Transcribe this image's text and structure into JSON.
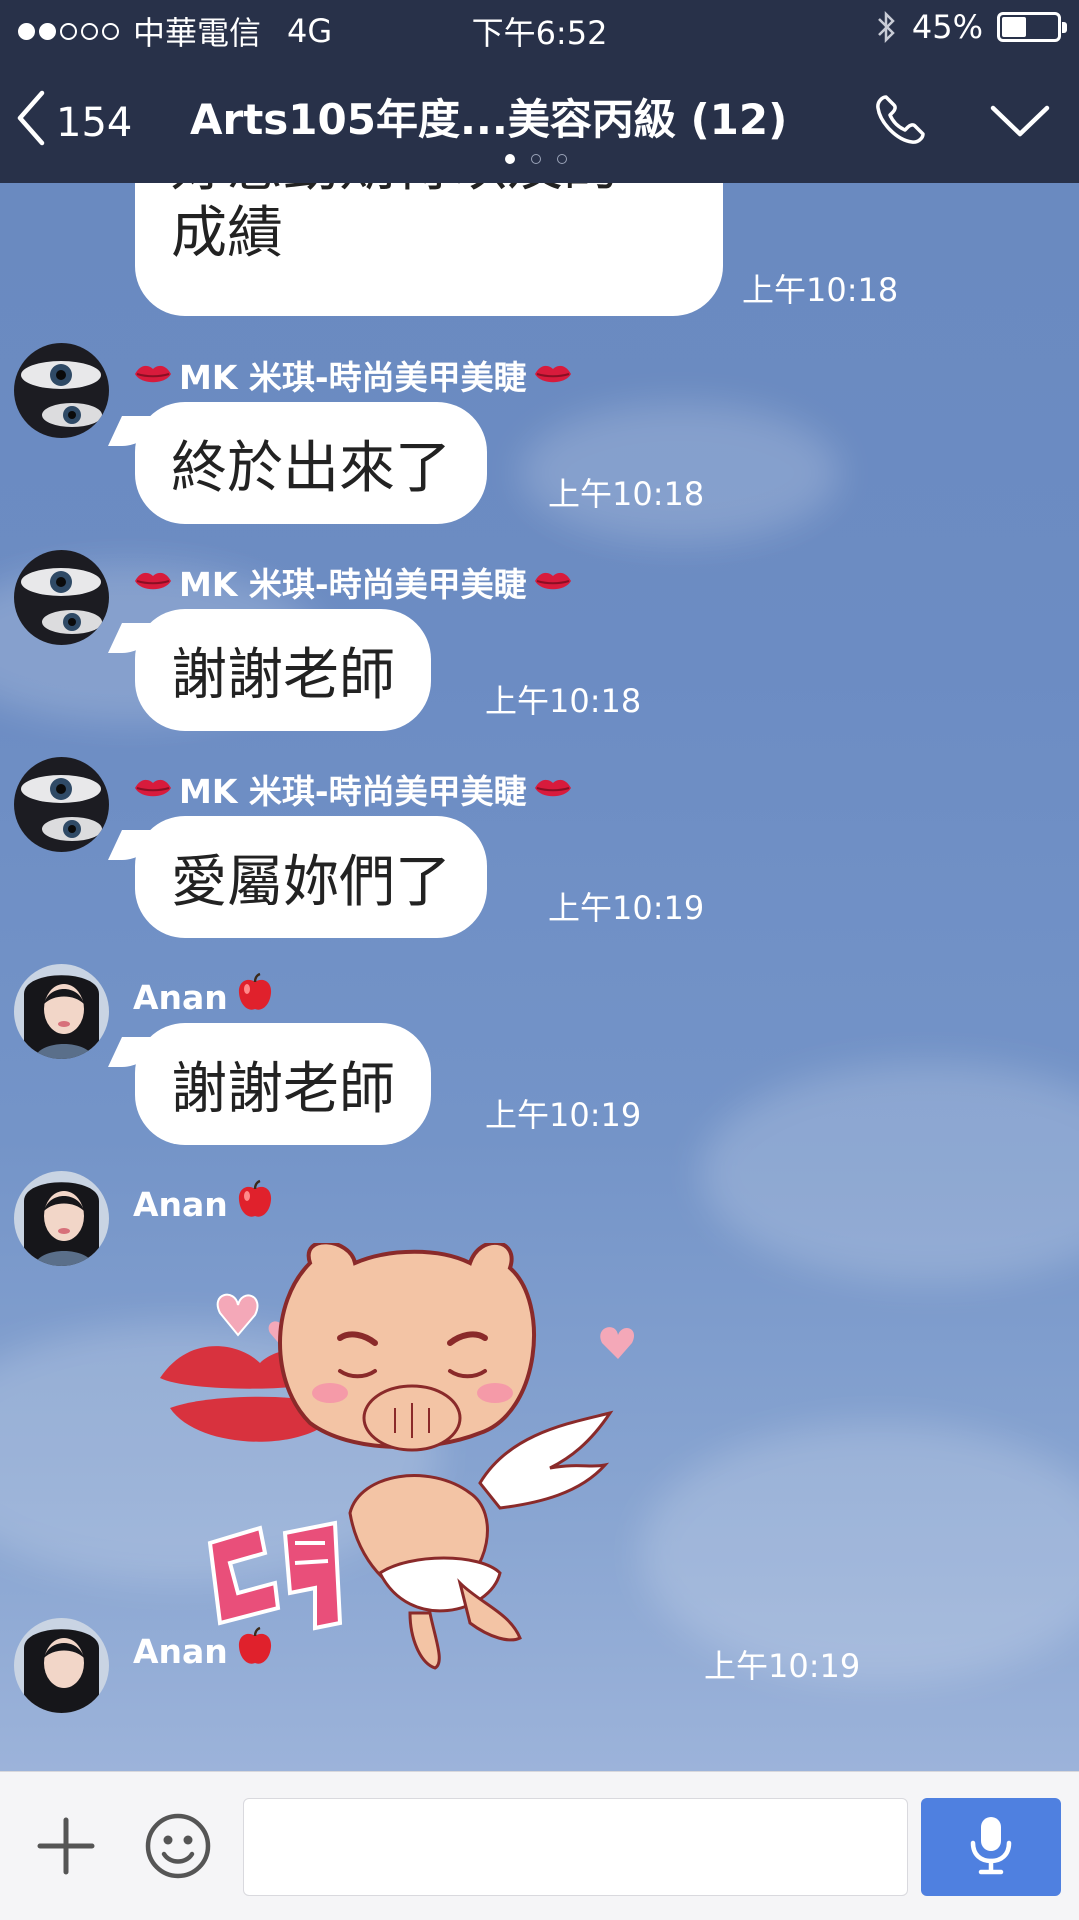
{
  "status_bar": {
    "carrier": "中華電信",
    "network": "4G",
    "time": "下午6:52",
    "battery": "45%",
    "battery_level": 0.45,
    "signal_bars": 2,
    "signal_total": 5
  },
  "nav": {
    "back_count": "154",
    "title": "Arts105年度...美容丙級 (12)",
    "page_dots": 3,
    "active_page": 0
  },
  "messages": [
    {
      "sender": "",
      "text_partial": "好感動期待以及的",
      "text": "成績",
      "time": "上午10:18"
    },
    {
      "sender": "MK 米琪-時尚美甲美睫",
      "text": "終於出來了",
      "time": "上午10:18"
    },
    {
      "sender": "MK 米琪-時尚美甲美睫",
      "text": "謝謝老師",
      "time": "上午10:18"
    },
    {
      "sender": "MK 米琪-時尚美甲美睫",
      "text": "愛屬妳們了",
      "time": "上午10:19"
    },
    {
      "sender": "Anan",
      "text": "謝謝老師",
      "time": "上午10:19"
    },
    {
      "sender": "Anan",
      "sticker": "啾",
      "time": "上午10:19"
    },
    {
      "sender": "Anan"
    }
  ],
  "input": {
    "value": "",
    "placeholder": ""
  },
  "colors": {
    "header_bg": "#283149",
    "bubble_bg": "#ffffff",
    "mic_button": "#4f80e0"
  }
}
